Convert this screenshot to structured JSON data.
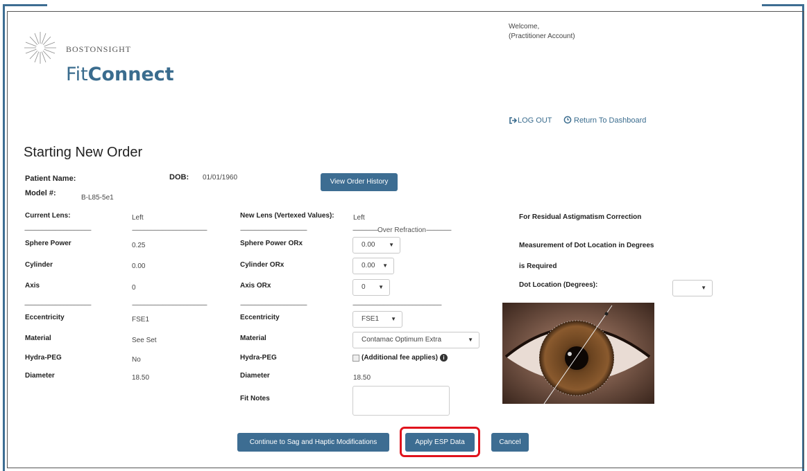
{
  "brand": {
    "top": "BOSTONSIGHT",
    "fit": "Fit",
    "connect": "Connect"
  },
  "header": {
    "welcome": "Welcome,",
    "account": "(Practitioner Account)",
    "logout": "LOG OUT",
    "dashboard": "Return To Dashboard"
  },
  "page": {
    "title": "Starting New Order"
  },
  "patient": {
    "name_label": "Patient Name:",
    "dob_label": "DOB:",
    "dob_value": "01/01/1960",
    "model_label": "Model #:",
    "model_value": "B-L85-5e1",
    "history_button": "View Order History"
  },
  "current": {
    "heading": "Current Lens:",
    "eye": "Left",
    "rows": [
      {
        "label": "Sphere Power",
        "value": "0.25"
      },
      {
        "label": "Cylinder",
        "value": "0.00"
      },
      {
        "label": "Axis",
        "value": "0"
      },
      {
        "label": "Eccentricity",
        "value": "FSE1"
      },
      {
        "label": "Material",
        "value": "See Set"
      },
      {
        "label": "Hydra-PEG",
        "value": "No"
      },
      {
        "label": "Diameter",
        "value": "18.50"
      }
    ]
  },
  "newlens": {
    "heading": "New Lens (Vertexed Values):",
    "eye": "Left",
    "over_refraction": "Over Refraction",
    "sphere_label": "Sphere Power ORx",
    "sphere_value": "0.00",
    "cylinder_label": "Cylinder ORx",
    "cylinder_value": "0.00",
    "axis_label": "Axis ORx",
    "axis_value": "0",
    "eccentricity_label": "Eccentricity",
    "eccentricity_value": "FSE1",
    "material_label": "Material",
    "material_value": "Contamac Optimum Extra",
    "hydrapeg_label": "Hydra-PEG",
    "hydrapeg_text": "(Additional fee applies)",
    "diameter_label": "Diameter",
    "diameter_value": "18.50",
    "fitnotes_label": "Fit Notes",
    "fitnotes_value": ""
  },
  "residual": {
    "line1": "For Residual Astigmatism Correction",
    "line2": "Measurement of Dot Location in Degrees",
    "line3": "is Required",
    "dot_label": "Dot Location (Degrees):",
    "dot_value": ""
  },
  "actions": {
    "continue": "Continue to Sag and Haptic Modifications",
    "apply": "Apply ESP Data",
    "cancel": "Cancel"
  },
  "colors": {
    "accent": "#3d6d92",
    "highlight": "#e0131c"
  }
}
